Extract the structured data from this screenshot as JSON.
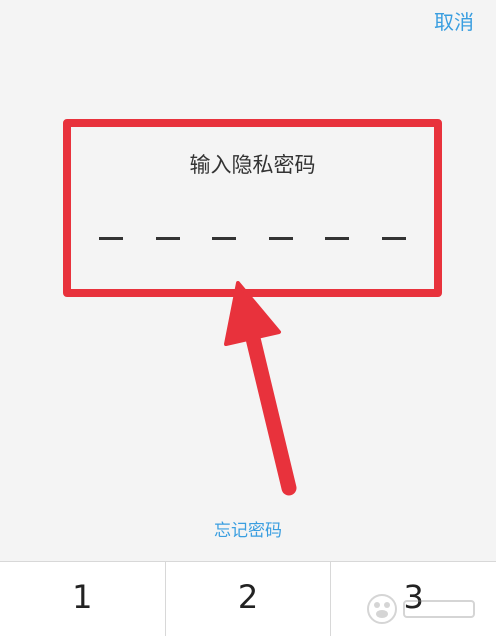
{
  "header": {
    "cancel_label": "取消"
  },
  "prompt": {
    "title": "输入隐私密码",
    "pin_length": 6
  },
  "links": {
    "forgot_password": "忘记密码"
  },
  "keypad": {
    "keys": [
      "1",
      "2",
      "3"
    ]
  },
  "annotation": {
    "highlight_color": "#e8323c"
  },
  "colors": {
    "accent": "#3a9ee0",
    "background": "#f4f4f4"
  }
}
